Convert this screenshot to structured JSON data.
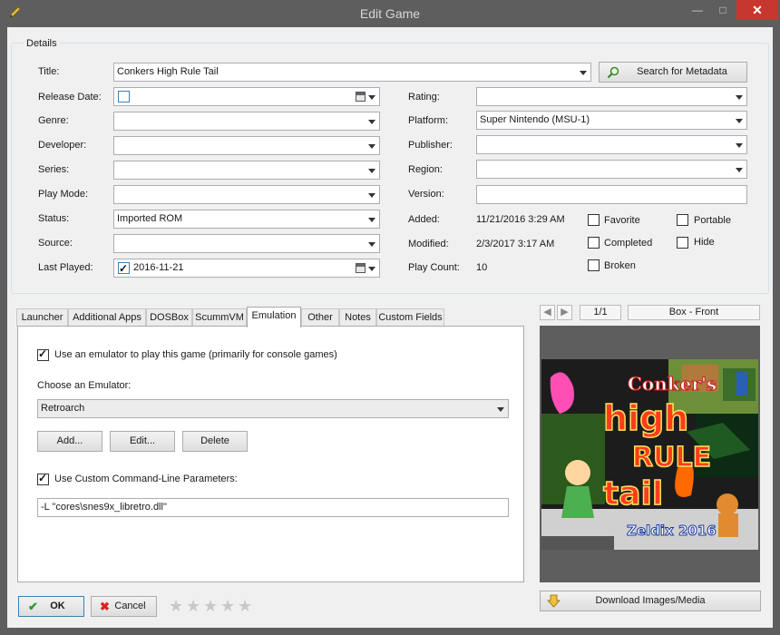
{
  "window": {
    "title": "Edit Game",
    "minimize": "—",
    "maximize": "□",
    "close": "✕"
  },
  "details": {
    "group_label": "Details",
    "title_label": "Title:",
    "title_value": "Conkers High Rule Tail",
    "search_metadata": "Search for Metadata",
    "release_date_label": "Release Date:",
    "release_date_value": "",
    "genre_label": "Genre:",
    "developer_label": "Developer:",
    "series_label": "Series:",
    "play_mode_label": "Play Mode:",
    "status_label": "Status:",
    "status_value": "Imported ROM",
    "source_label": "Source:",
    "last_played_label": "Last Played:",
    "last_played_value": "2016-11-21",
    "rating_label": "Rating:",
    "platform_label": "Platform:",
    "platform_value": "Super Nintendo (MSU-1)",
    "publisher_label": "Publisher:",
    "region_label": "Region:",
    "version_label": "Version:",
    "added_label": "Added:",
    "added_value": "11/21/2016 3:29 AM",
    "modified_label": "Modified:",
    "modified_value": "2/3/2017 3:17 AM",
    "play_count_label": "Play Count:",
    "play_count_value": "10",
    "favorite": "Favorite",
    "completed": "Completed",
    "broken": "Broken",
    "portable": "Portable",
    "hide": "Hide"
  },
  "tabs": [
    "Launcher",
    "Additional Apps",
    "DOSBox",
    "ScummVM",
    "Emulation",
    "Other",
    "Notes",
    "Custom Fields"
  ],
  "emulation": {
    "use_emulator": "Use an emulator to play this game (primarily for console games)",
    "choose_label": "Choose an Emulator:",
    "emulator_value": "Retroarch",
    "add": "Add...",
    "edit": "Edit...",
    "delete": "Delete",
    "custom_cmd": "Use Custom Command-Line Parameters:",
    "cmd_value": "-L \"cores\\snes9x_libretro.dll\""
  },
  "images": {
    "counter": "1/1",
    "image_type": "Box - Front",
    "download": "Download Images/Media",
    "cover_title_1": "Conker's",
    "cover_title_2": "high",
    "cover_title_3": "RULE",
    "cover_title_4": "tail",
    "cover_credit": "Zeldix 2016"
  },
  "footer": {
    "ok": "OK",
    "cancel": "Cancel",
    "rating_stars": 0,
    "star_glyph": "★"
  },
  "colors": {
    "chrome": "#5e5e5e",
    "close": "#c7372f",
    "panel": "#f0f0f0"
  }
}
